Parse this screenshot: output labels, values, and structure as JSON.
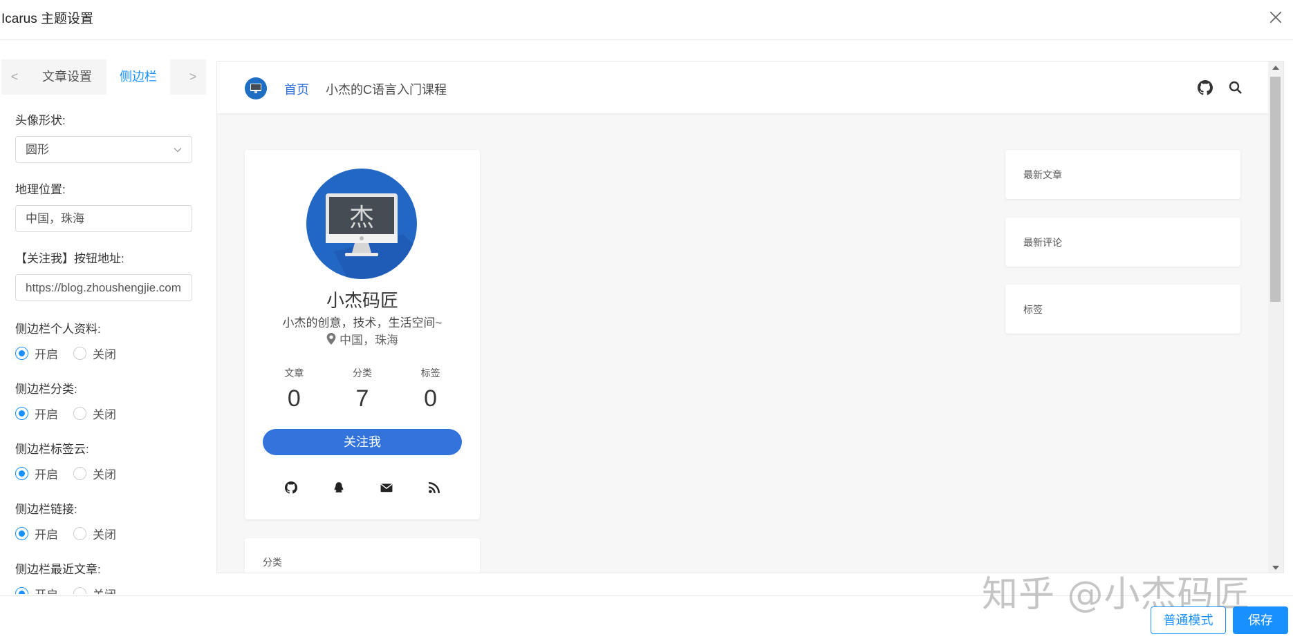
{
  "window": {
    "title": "Icarus 主题设置"
  },
  "tabs": {
    "prev": "<",
    "next": ">",
    "items": [
      {
        "label": "文章设置"
      },
      {
        "label": "侧边栏"
      }
    ]
  },
  "form": {
    "avatar_shape": {
      "label": "头像形状:",
      "value": "圆形"
    },
    "location": {
      "label": "地理位置:",
      "value": "中国，珠海"
    },
    "follow_url": {
      "label": "【关注我】按钮地址:",
      "value": "https://blog.zhoushengjie.com"
    },
    "radio_groups": [
      {
        "label": "侧边栏个人资料:",
        "on": "开启",
        "off": "关闭",
        "selected": "开启"
      },
      {
        "label": "侧边栏分类:",
        "on": "开启",
        "off": "关闭",
        "selected": "开启"
      },
      {
        "label": "侧边栏标签云:",
        "on": "开启",
        "off": "关闭",
        "selected": "开启"
      },
      {
        "label": "侧边栏链接:",
        "on": "开启",
        "off": "关闭",
        "selected": "开启"
      },
      {
        "label": "侧边栏最近文章:",
        "on": "开启",
        "off": "关闭",
        "selected": "开启"
      }
    ]
  },
  "preview": {
    "nav": {
      "home": "首页",
      "course": "小杰的C语言入门课程",
      "icons": [
        "github-icon",
        "search-icon"
      ]
    },
    "avatar_char": "杰",
    "profile": {
      "name": "小杰码匠",
      "tagline": "小杰的创意，技术，生活空间~",
      "location": "中国，珠海",
      "stats": [
        {
          "label": "文章",
          "value": "0"
        },
        {
          "label": "分类",
          "value": "7"
        },
        {
          "label": "标签",
          "value": "0"
        }
      ],
      "follow": "关注我",
      "socials": [
        "github-icon",
        "qq-icon",
        "mail-icon",
        "rss-icon"
      ]
    },
    "category_card": "分类",
    "widgets": [
      {
        "title": "最新文章"
      },
      {
        "title": "最新评论"
      },
      {
        "title": "标签"
      }
    ]
  },
  "footer": {
    "normal_mode": "普通模式",
    "save": "保存"
  },
  "watermark": "知乎 @小杰码匠",
  "colors": {
    "accent": "#1890ff",
    "theme_blue": "#3273dc"
  }
}
